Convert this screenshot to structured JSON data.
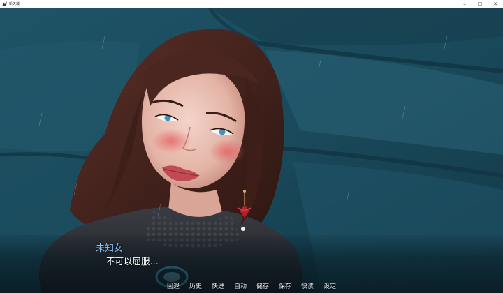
{
  "window": {
    "title": "新天域",
    "app_icon": "app-icon",
    "controls": [
      "–",
      "☐",
      "✕"
    ]
  },
  "dialogue": {
    "speaker": "未知女",
    "speaker_color": "#8fc4ff",
    "text": "不可以屈服…"
  },
  "quick_menu": {
    "items": [
      "回退",
      "历史",
      "快进",
      "自动",
      "储存",
      "保存",
      "快读",
      "设定"
    ]
  },
  "colors": {
    "background_teal": "#1c4e60",
    "hair": "#4a2620",
    "suit": "#2b2d33"
  }
}
